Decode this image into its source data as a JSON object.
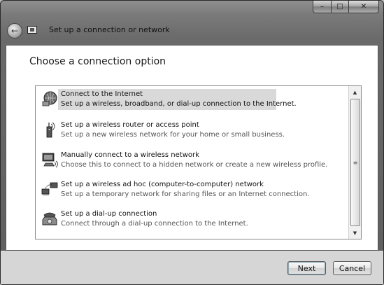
{
  "window": {
    "title": "Set up a connection or network",
    "caption_buttons": {
      "minimize": "–",
      "maximize": "□",
      "close": "✕"
    },
    "back_glyph": "←"
  },
  "main": {
    "heading": "Choose a connection option",
    "options": [
      {
        "icon": "globe-network-icon",
        "title": "Connect to the Internet",
        "description": "Set up a wireless, broadband, or dial-up connection to the Internet.",
        "selected": true
      },
      {
        "icon": "wireless-router-icon",
        "title": "Set up a wireless router or access point",
        "description": "Set up a new wireless network for your home or small business.",
        "selected": false
      },
      {
        "icon": "computer-wireless-icon",
        "title": "Manually connect to a wireless network",
        "description": "Choose this to connect to a hidden network or create a new wireless profile.",
        "selected": false
      },
      {
        "icon": "adhoc-network-icon",
        "title": "Set up a wireless ad hoc (computer-to-computer) network",
        "description": "Set up a temporary network for sharing files or an Internet connection.",
        "selected": false
      },
      {
        "icon": "dialup-phone-icon",
        "title": "Set up a dial-up connection",
        "description": "Connect through a dial-up connection to the Internet.",
        "selected": false
      }
    ],
    "scrollbar": {
      "up": "▲",
      "down": "▼",
      "grip": "≡"
    }
  },
  "footer": {
    "next_label": "Next",
    "cancel_label": "Cancel"
  }
}
